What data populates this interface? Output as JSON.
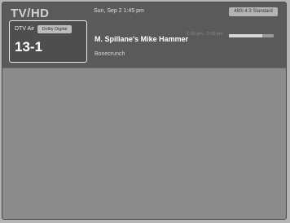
{
  "banner": {
    "mode": "TV/HD",
    "date_time": "Sun, Sep 2  1:45 pm",
    "resolution": "480i  4:3  Standard",
    "channel": {
      "source": "DTV Air",
      "audio": "Dolby Digital",
      "number": "13-1"
    },
    "program": {
      "title": "M. Spillane's Mike Hammer",
      "time": "1:00 pm - 2:00 pm",
      "progress": 0.75,
      "genre": "Bonecrunch"
    }
  }
}
